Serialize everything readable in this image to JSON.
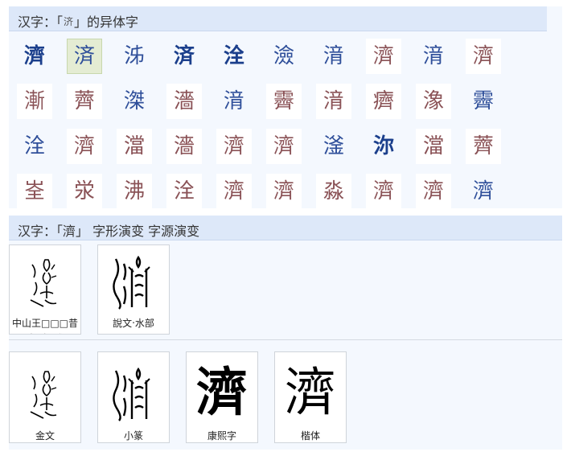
{
  "variants_section": {
    "title_prefix": "汉字：「",
    "title_char": "济",
    "title_suffix": "」的异体字",
    "rows": [
      [
        {
          "char": "濟",
          "style": "dblue"
        },
        {
          "char": "済",
          "style": "sel"
        },
        {
          "char": "泲",
          "style": "blue"
        },
        {
          "char": "済",
          "style": "dblue"
        },
        {
          "char": "洤",
          "style": "dblue"
        },
        {
          "char": "澰",
          "style": "blue"
        },
        {
          "char": "湇",
          "style": "blue"
        },
        {
          "char": "濟",
          "style": "red"
        },
        {
          "char": "湇",
          "style": "blue"
        },
        {
          "char": "濟",
          "style": "red"
        }
      ],
      [
        {
          "char": "漸",
          "style": "red"
        },
        {
          "char": "薺",
          "style": "red"
        },
        {
          "char": "滐",
          "style": "blue"
        },
        {
          "char": "濇",
          "style": "red"
        },
        {
          "char": "湇",
          "style": "blue"
        },
        {
          "char": "霽",
          "style": "red"
        },
        {
          "char": "湇",
          "style": "red"
        },
        {
          "char": "癠",
          "style": "red"
        },
        {
          "char": "潒",
          "style": "red"
        },
        {
          "char": "霽",
          "style": "blue"
        }
      ],
      [
        {
          "char": "洤",
          "style": "blue"
        },
        {
          "char": "濟",
          "style": "red"
        },
        {
          "char": "澢",
          "style": "red"
        },
        {
          "char": "濇",
          "style": "red"
        },
        {
          "char": "濟",
          "style": "red"
        },
        {
          "char": "濟",
          "style": "red"
        },
        {
          "char": "滏",
          "style": "blue"
        },
        {
          "char": "沵",
          "style": "dblue"
        },
        {
          "char": "澢",
          "style": "red"
        },
        {
          "char": "薺",
          "style": "red"
        }
      ],
      [
        {
          "char": "峑",
          "style": "red"
        },
        {
          "char": "泶",
          "style": "red"
        },
        {
          "char": "沸",
          "style": "red"
        },
        {
          "char": "洤",
          "style": "red"
        },
        {
          "char": "濟",
          "style": "red"
        },
        {
          "char": "濟",
          "style": "red"
        },
        {
          "char": "淼",
          "style": "red"
        },
        {
          "char": "濟",
          "style": "red"
        },
        {
          "char": "濟",
          "style": "red"
        },
        {
          "char": "濟",
          "style": "blue"
        }
      ]
    ]
  },
  "evolution_section": {
    "title": "汉字：「濟」 字形演变 字源演变",
    "top_row": [
      {
        "glyph": "𣲡",
        "caption": "中山王□□□昔□壺(金)戰國",
        "style": "anc"
      },
      {
        "glyph": "𣶒",
        "caption": "說文‧水部",
        "style": "seal"
      }
    ],
    "bottom_row": [
      {
        "glyph": "𣲡",
        "caption": "金文",
        "style": "anc"
      },
      {
        "glyph": "𣶒",
        "caption": "小篆",
        "style": "seal"
      },
      {
        "glyph": "濟",
        "caption": "康熙字",
        "style": "bold"
      },
      {
        "glyph": "濟",
        "caption": "楷体",
        "style": "kai"
      }
    ]
  }
}
